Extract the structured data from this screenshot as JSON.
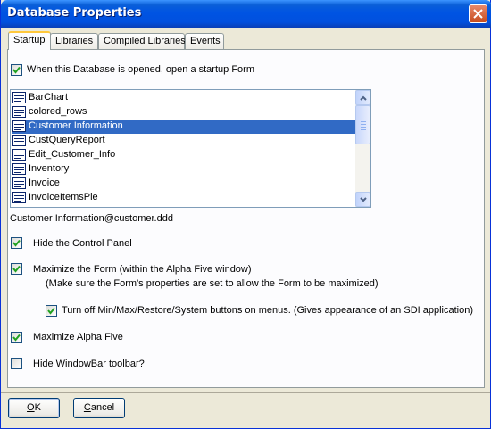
{
  "window": {
    "title": "Database Properties"
  },
  "tabs": [
    {
      "label": "Startup"
    },
    {
      "label": "Libraries"
    },
    {
      "label": "Compiled Libraries"
    },
    {
      "label": "Events"
    }
  ],
  "startup": {
    "open_form_checkbox": {
      "label": "When this Database is opened, open a startup Form",
      "checked": true
    },
    "forms_list": {
      "items": [
        "BarChart",
        "colored_rows",
        "Customer Information",
        "CustQueryReport",
        "Edit_Customer_Info",
        "Inventory",
        "Invoice",
        "InvoiceItemsPie"
      ],
      "selected": "Customer Information"
    },
    "selected_form_path": "Customer Information@customer.ddd",
    "hide_control_panel": {
      "label": "Hide the Control Panel",
      "checked": true
    },
    "maximize_form": {
      "label": "Maximize the Form (within the Alpha Five window)",
      "note": "(Make sure the Form's properties are set to allow the Form to be maximized)",
      "checked": true
    },
    "turn_off_buttons": {
      "label": "Turn off Min/Max/Restore/System buttons on menus. (Gives appearance of an SDI application)",
      "checked": true
    },
    "maximize_alpha_five": {
      "label": "Maximize Alpha Five",
      "checked": true
    },
    "hide_windowbar": {
      "label": "Hide WindowBar toolbar?",
      "checked": false
    }
  },
  "buttons": {
    "ok": {
      "mnemonic": "O",
      "rest": "K"
    },
    "cancel": {
      "mnemonic": "C",
      "rest": "ancel"
    }
  },
  "icons": {
    "close": "close-icon",
    "check": "checkmark-icon",
    "form": "form-icon",
    "scroll_up": "chevron-up-icon",
    "scroll_down": "chevron-down-icon"
  },
  "colors": {
    "titlebar": "#0054e3",
    "selection": "#316ac5",
    "active_tab_accent": "#ffc83c",
    "dialog_bg": "#ece9d8"
  }
}
